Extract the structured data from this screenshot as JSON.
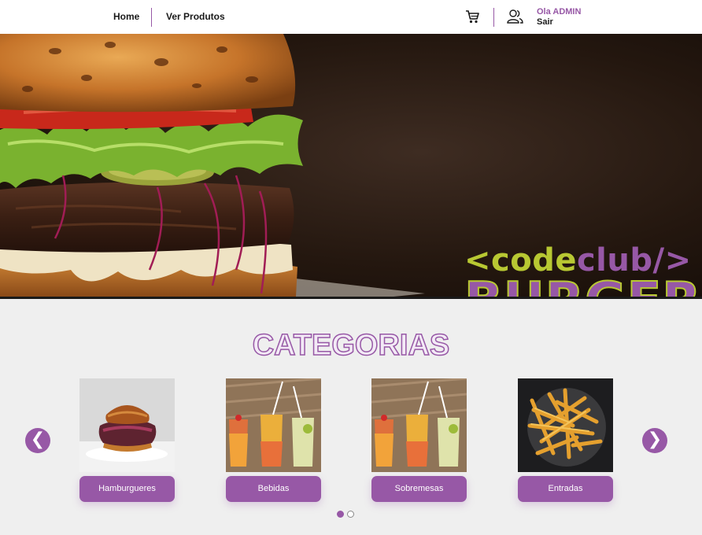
{
  "nav": {
    "home_label": "Home",
    "products_label": "Ver Produtos",
    "greeting": "Ola ADMIN",
    "logout_label": "Sair"
  },
  "hero": {
    "brand_open": "<code",
    "brand_club": "club/>",
    "brand_burger": "BURGER"
  },
  "categories": {
    "title": "CATEGORIAS",
    "prev_glyph": "❮",
    "next_glyph": "❯",
    "items": [
      {
        "label": "Hamburgueres"
      },
      {
        "label": "Bebidas"
      },
      {
        "label": "Sobremesas"
      },
      {
        "label": "Entradas"
      }
    ]
  },
  "colors": {
    "accent": "#9758a6",
    "brand_green": "#b8c832",
    "background": "#efefef"
  }
}
